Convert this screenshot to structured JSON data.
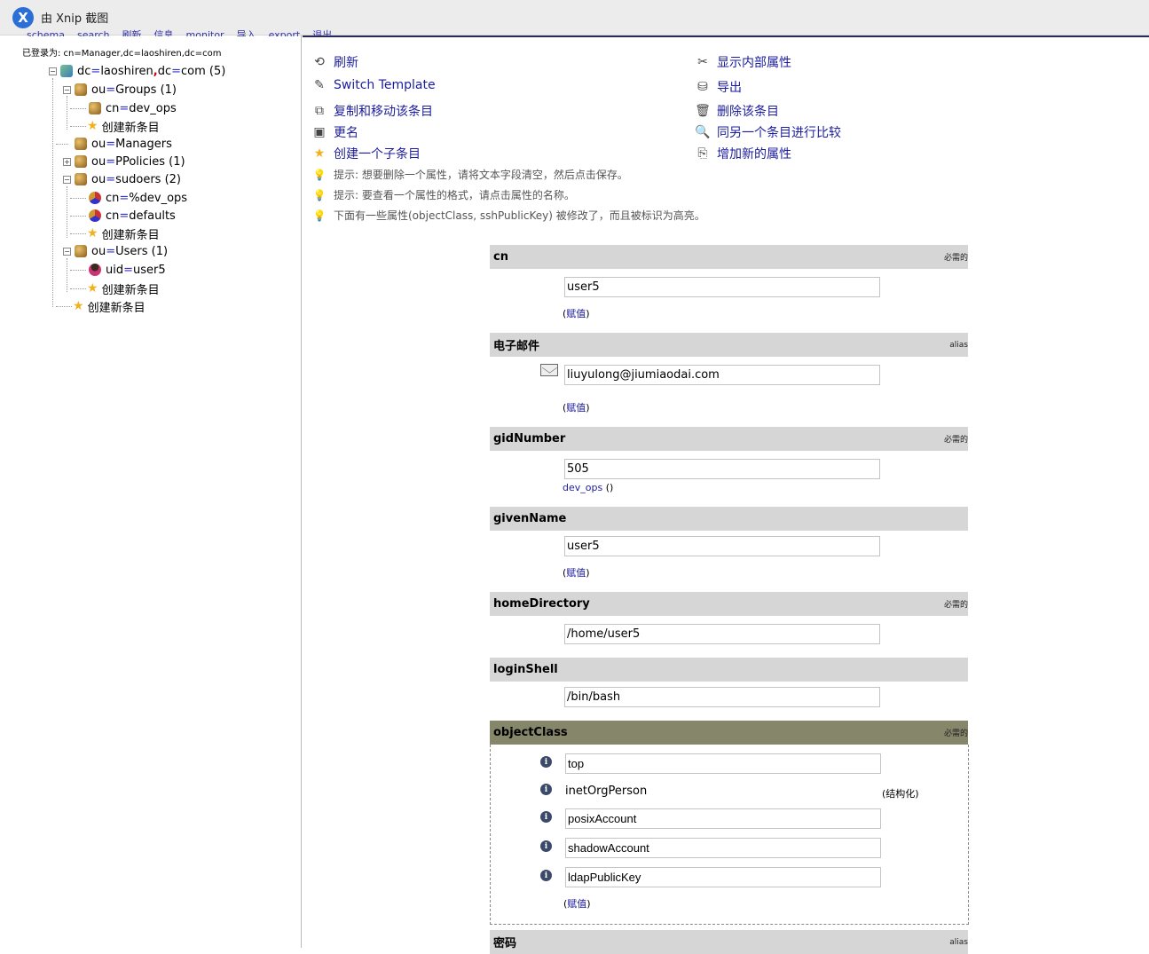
{
  "xnip": {
    "title": "由 Xnip 截图",
    "logo": "X"
  },
  "topnav": {
    "items": [
      "schema",
      "search",
      "刷新",
      "信息",
      "monitor",
      "导入",
      "export",
      "退出"
    ]
  },
  "left": {
    "logged_in": "已登录为: cn=Manager,dc=laoshiren,dc=com",
    "root": {
      "toggle": "−",
      "a": "dc",
      "eq": "=",
      "b": "laoshiren",
      "sep": ",",
      "c": "dc",
      "eq2": "=",
      "d": "com (5)"
    },
    "nodes": [
      {
        "toggle": "−",
        "key": "ou",
        "val": "Groups (1)"
      },
      {
        "key": "cn",
        "val": "dev_ops"
      },
      {
        "label": "创建新条目"
      },
      {
        "key": "ou",
        "val": "Managers"
      },
      {
        "toggle": "+",
        "key": "ou",
        "val": "PPolicies (1)"
      },
      {
        "toggle": "−",
        "key": "ou",
        "val": "sudoers (2)"
      },
      {
        "key": "cn",
        "val": "%dev_ops"
      },
      {
        "key": "cn",
        "val": "defaults"
      },
      {
        "label": "创建新条目"
      },
      {
        "toggle": "−",
        "key": "ou",
        "val": "Users (1)"
      },
      {
        "key": "uid",
        "val": "user5"
      },
      {
        "label": "创建新条目"
      },
      {
        "label": "创建新条目"
      }
    ],
    "eq": "="
  },
  "actions": {
    "refresh": "刷新",
    "switch_template": "Switch Template",
    "copy_move": "复制和移动该条目",
    "rename": "更名",
    "create_child": "创建一个子条目",
    "show_internal": "显示内部属性",
    "export": "导出",
    "delete": "删除该条目",
    "compare": "同另一个条目进行比较",
    "add_attr": "增加新的属性"
  },
  "hints": {
    "h1": "提示:   想要删除一个属性，请将文本字段清空，然后点击保存。",
    "h2": "提示:   要查看一个属性的格式，请点击属性的名称。",
    "h3": "下面有一些属性(objectClass, sshPublicKey) 被修改了，而且被标识为高亮。"
  },
  "attrs": {
    "cn": {
      "name": "cn",
      "tag": "必需的",
      "value": "user5",
      "add_open": "(",
      "add": "赋值",
      "add_close": ")"
    },
    "email": {
      "name": "电子邮件",
      "tag": "alias",
      "value": "liuyulong@jiumiaodai.com",
      "add_open": "(",
      "add": "赋值",
      "add_close": ")"
    },
    "gid": {
      "name": "gidNumber",
      "tag": "必需的",
      "value": "505",
      "link": "dev_ops",
      "link_suffix": " ()"
    },
    "given": {
      "name": "givenName",
      "value": "user5",
      "add_open": "(",
      "add": "赋值",
      "add_close": ")"
    },
    "home": {
      "name": "homeDirectory",
      "tag": "必需的",
      "value": "/home/user5"
    },
    "shell": {
      "name": "loginShell",
      "value": "/bin/bash"
    },
    "oc": {
      "name": "objectClass",
      "tag": "必需的",
      "values": [
        "top",
        "inetOrgPerson",
        "posixAccount",
        "shadowAccount",
        "ldapPublicKey"
      ],
      "structural": "(结构化)",
      "add_open": "(",
      "add": "赋值",
      "add_close": ")"
    },
    "pwd": {
      "name": "密码",
      "tag": "alias"
    }
  },
  "colors": {
    "link": "#1c1c9e",
    "header": "#d6d6d6",
    "header_modified": "#86866b"
  }
}
